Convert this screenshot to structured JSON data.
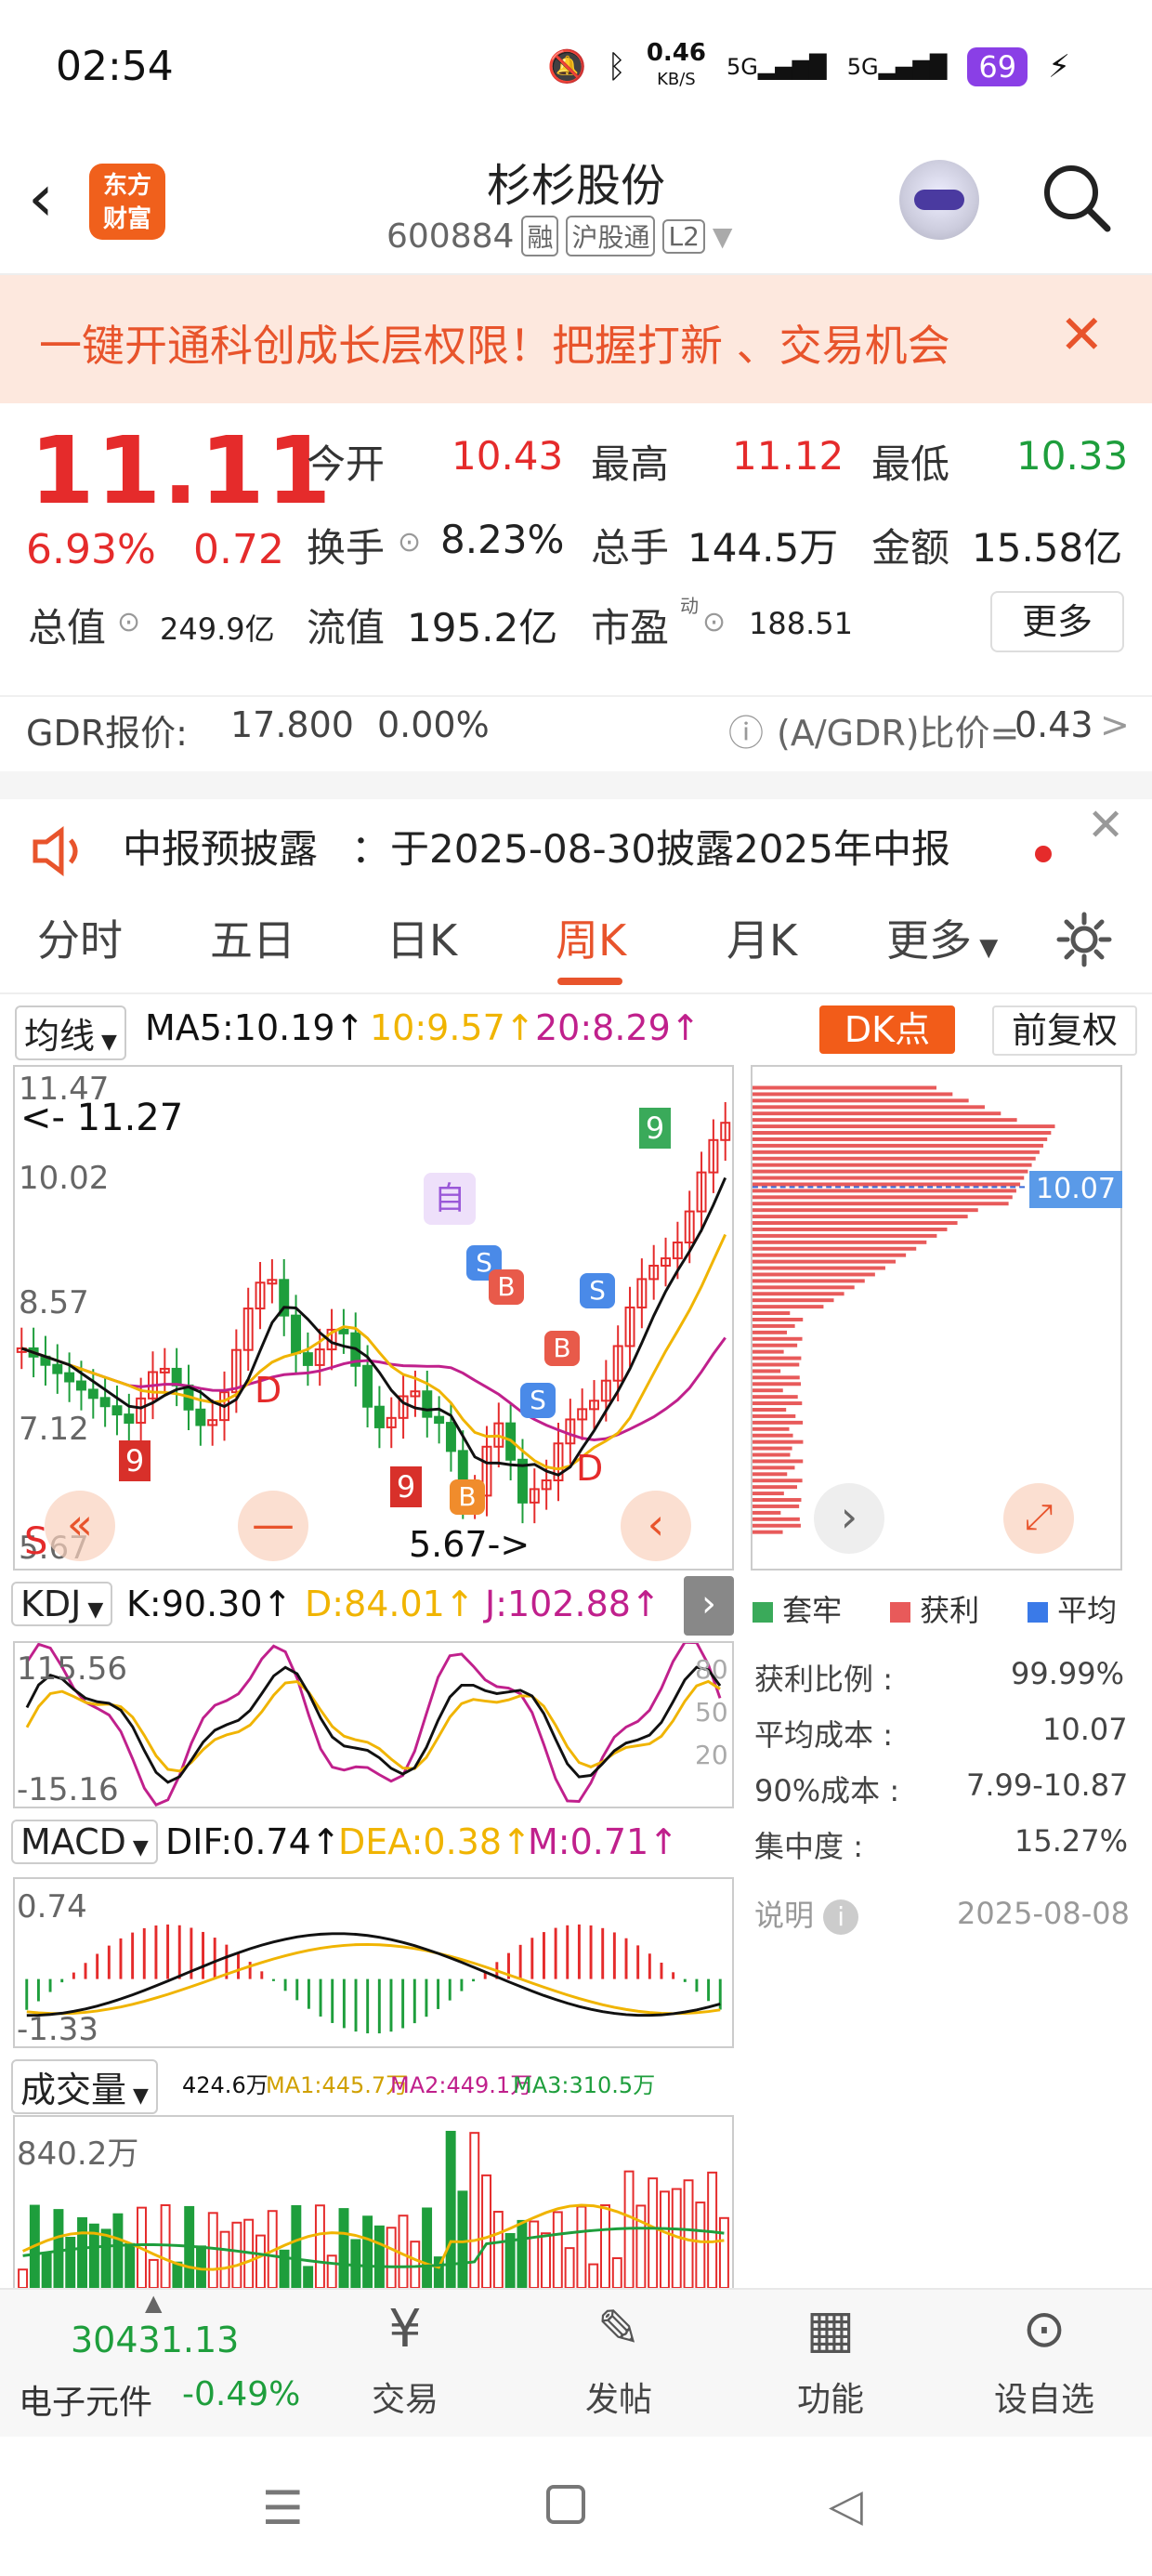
{
  "status": {
    "time": "02:54",
    "speed": "0.46",
    "speed_unit": "KB/S",
    "net1": "5G",
    "net2": "5G",
    "battery": "69"
  },
  "header": {
    "name": "杉杉股份",
    "code": "600884",
    "tags": [
      "融",
      "沪股通",
      "L2"
    ],
    "logo_line1": "东方",
    "logo_line2": "财富"
  },
  "banner": {
    "text": "一键开通科创成长层权限！把握打新 、交易机会"
  },
  "quote": {
    "price": "11.11",
    "pct": "6.93%",
    "chg": "0.72",
    "open_label": "今开",
    "open": "10.43",
    "high_label": "最高",
    "high": "11.12",
    "low_label": "最低",
    "low": "10.33",
    "turn_label": "换手",
    "turn": "8.23%",
    "vol_label": "总手",
    "vol": "144.5万",
    "amt_label": "金额",
    "amt": "15.58亿",
    "mcap_label": "总值",
    "mcap": "249.9亿",
    "float_label": "流值",
    "float": "195.2亿",
    "pe_label": "市盈",
    "pe_sup": "动",
    "pe": "188.51",
    "more": "更多"
  },
  "gdr": {
    "label": "GDR报价:",
    "price": "17.800",
    "pct": "0.00%",
    "ratio_label": "(A/GDR)比价=",
    "ratio": "0.43",
    "arrow": ">"
  },
  "notice": {
    "label": "中报预披露",
    "text": "：于2025-08-30披露2025年中报"
  },
  "tabs": [
    "分时",
    "五日",
    "日K",
    "周K",
    "月K",
    "更多"
  ],
  "kchart": {
    "indicator": "均线",
    "ma5": "MA5:10.19",
    "ma10": "10:9.57",
    "ma20": "20:8.29",
    "dk": "DK点",
    "fq": "前复权",
    "top_price": "11.47",
    "max_label": "<- 11.27",
    "p1": "10.02",
    "p2": "8.57",
    "p3": "7.12",
    "low_price": "5.67",
    "min_label": "5.67->",
    "self_tag": "自",
    "chip_price": "10.07"
  },
  "chips": {
    "legend": [
      "套牢",
      "获利",
      "平均"
    ],
    "rows": [
      {
        "k": "获利比例",
        "v": "99.99%"
      },
      {
        "k": "平均成本",
        "v": "10.07"
      },
      {
        "k": "90%成本",
        "v": "7.99-10.87"
      },
      {
        "k": "集中度",
        "v": "15.27%"
      }
    ],
    "note": "说明",
    "date": "2025-08-08"
  },
  "kdj": {
    "name": "KDJ",
    "k": "K:90.30",
    "d": "D:84.01",
    "j": "J:102.88",
    "top": "115.56",
    "bottom": "-15.16",
    "l80": "80",
    "l50": "50",
    "l20": "20"
  },
  "macd": {
    "name": "MACD",
    "dif": "DIF:0.74",
    "dea": "DEA:0.38",
    "m": "M:0.71",
    "top": "0.74",
    "bottom": "-1.33"
  },
  "volume": {
    "name": "成交量",
    "v": "424.6万",
    "ma1": "MA1:445.7万",
    "ma2": "MA2:449.1万",
    "ma3": "MA3:310.5万",
    "top": "840.2万"
  },
  "bottom": {
    "index_value": "30431.13",
    "index_name": "电子元件",
    "index_pct": "-0.49%",
    "items": [
      "交易",
      "发帖",
      "功能",
      "设自选"
    ]
  },
  "colors": {
    "up": "#e52b2b",
    "down": "#1e9e3c",
    "accent": "#e8542c",
    "ma5": "#111111",
    "ma10": "#f0b400",
    "ma20": "#c0208c"
  }
}
